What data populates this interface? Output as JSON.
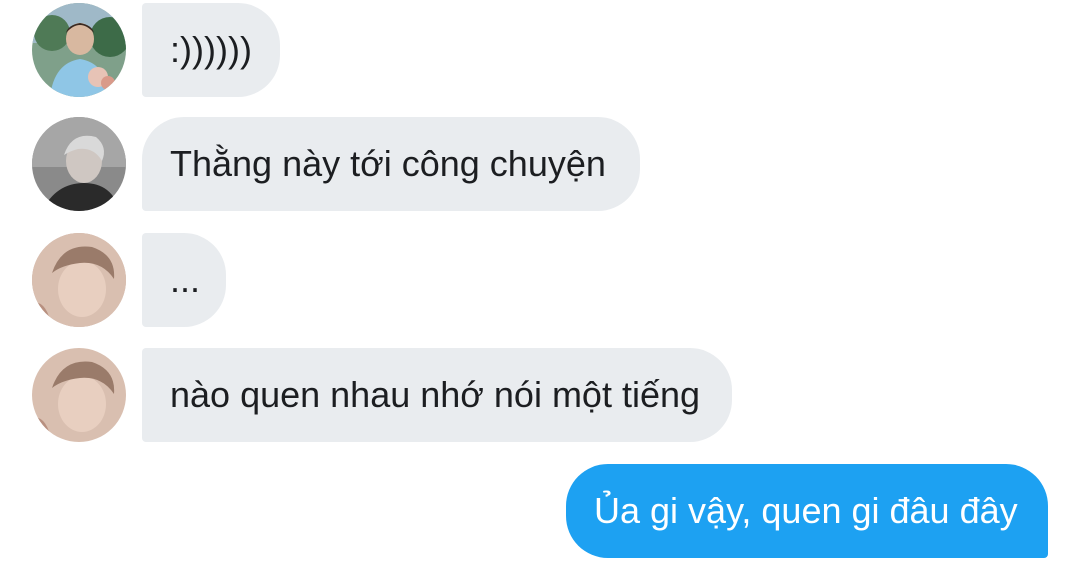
{
  "messages": [
    {
      "text": ":))))))",
      "avatar": "user-a-avatar"
    },
    {
      "text": "Thằng này tới công chuyện",
      "avatar": "user-b-avatar"
    },
    {
      "text": "...",
      "avatar": "user-c-avatar"
    },
    {
      "text": "nào quen nhau nhớ nói một tiếng",
      "avatar": "user-c-avatar"
    },
    {
      "text": "Ủa gi vậy, quen gi đâu đây",
      "sender": "self"
    }
  ],
  "colors": {
    "incoming_bubble": "#e9ecef",
    "outgoing_bubble": "#1da1f2",
    "incoming_text": "#1c1e21",
    "outgoing_text": "#ffffff"
  }
}
